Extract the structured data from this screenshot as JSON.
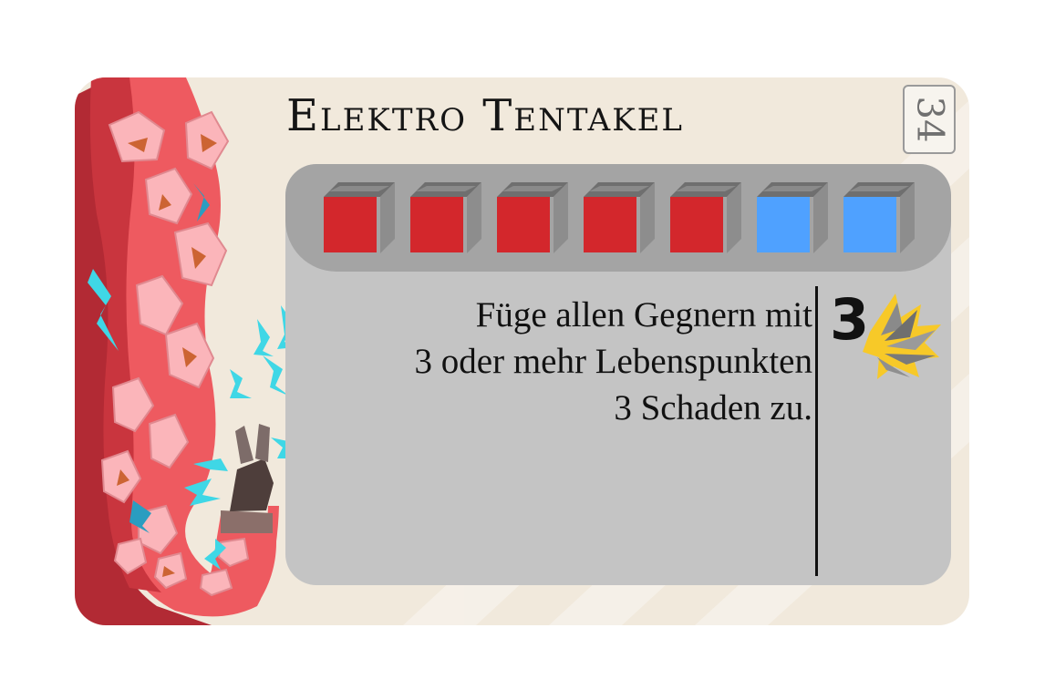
{
  "card": {
    "title": "Elektro Tentakel",
    "cost": "34",
    "cubes": [
      {
        "color": "red",
        "face": "#d3272c"
      },
      {
        "color": "red",
        "face": "#d3272c"
      },
      {
        "color": "red",
        "face": "#d3272c"
      },
      {
        "color": "red",
        "face": "#d3272c"
      },
      {
        "color": "red",
        "face": "#d3272c"
      },
      {
        "color": "blue",
        "face": "#4fa1ff"
      },
      {
        "color": "blue",
        "face": "#4fa1ff"
      }
    ],
    "effect_lines": [
      "Füge allen Gegnern mit",
      "3 oder mehr Lebenspunkten",
      "3 Schaden zu."
    ],
    "damage": {
      "value": "3",
      "icon": "explosion-icon"
    },
    "illustration": "electric-tentacle-icon"
  },
  "colors": {
    "card_background": "#f1e9dc",
    "panel": "#c4c4c4",
    "panel_header": "#a4a4a4",
    "tentacle": "#f05a5f",
    "sucker": "#fbb5ba",
    "lightning": "#3fd7e6"
  }
}
